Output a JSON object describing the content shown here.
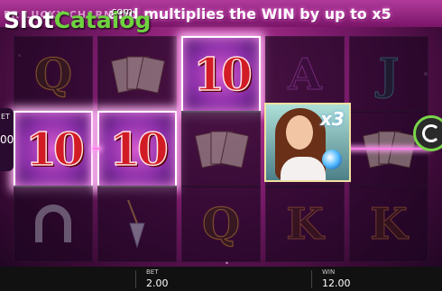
{
  "banner": {
    "faded_title": "ER LUCKY CHARM",
    "text": "and multiplies the WIN by up to x5"
  },
  "watermark": {
    "slot": "Slot",
    "catalog": "Catalog",
    "com": ".com"
  },
  "reels": [
    [
      "Q",
      "10",
      "horseshoe"
    ],
    [
      "cards",
      "10",
      "pendulum"
    ],
    [
      "10",
      "cards",
      "Q"
    ],
    [
      "A",
      "lucky-charm-x3",
      "K"
    ],
    [
      "J",
      "cards",
      "K"
    ]
  ],
  "wild": {
    "multiplier": "x3"
  },
  "side_left": {
    "label": "ET",
    "value": "00"
  },
  "bottom_bar": {
    "bet_label": "BET",
    "bet_value": "2.00",
    "win_label": "WIN",
    "win_value": "12.00"
  },
  "colors": {
    "win_frame": "#ffffff",
    "payline": "#ff7ce8",
    "spin_ring": "#7ad64a"
  }
}
